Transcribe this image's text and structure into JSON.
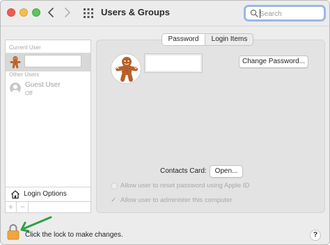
{
  "window": {
    "title": "Users & Groups"
  },
  "search": {
    "placeholder": "Search",
    "value": ""
  },
  "sidebar": {
    "current_user_label": "Current User",
    "other_users_label": "Other Users",
    "guest_user": {
      "name": "Guest User",
      "status": "Off"
    },
    "login_options_label": "Login Options",
    "add_label": "+",
    "remove_label": "−"
  },
  "tabs": [
    {
      "label": "Password",
      "selected": true
    },
    {
      "label": "Login Items",
      "selected": false
    }
  ],
  "main": {
    "change_password_label": "Change Password...",
    "contacts_card_label": "Contacts Card:",
    "open_button_label": "Open...",
    "options": [
      {
        "label": "Allow user to reset password using Apple ID",
        "checked": false,
        "enabled": false
      },
      {
        "label": "Allow user to administer this computer",
        "checked": true,
        "enabled": false
      }
    ]
  },
  "footer": {
    "lock_text": "Click the lock to make changes.",
    "help_label": "?"
  },
  "colors": {
    "close": "#ee5d55",
    "minimize": "#f4be4f",
    "maximize": "#5fc45a",
    "search_focus": "#9bb7e6",
    "lock": "#f0a63a",
    "annotation_arrow": "#2ea043"
  },
  "icons": {
    "back": "chevron-left-icon",
    "forward": "chevron-right-icon",
    "grid": "grid-icon",
    "search": "search-icon",
    "user_picture": "gingerbread-icon",
    "guest": "person-icon",
    "login_options": "house-icon",
    "lock": "lock-icon"
  }
}
